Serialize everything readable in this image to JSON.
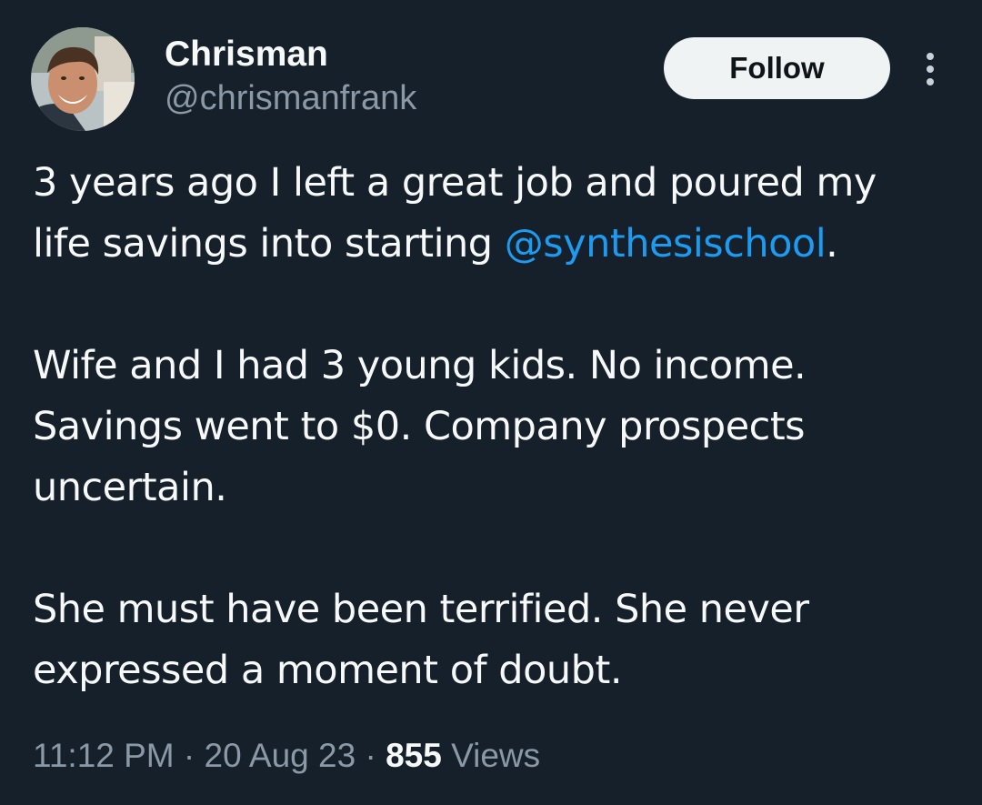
{
  "author": {
    "display_name": "Chrisman",
    "handle": "@chrismanfrank"
  },
  "actions": {
    "follow_label": "Follow",
    "more_icon": "more-vertical-icon"
  },
  "tweet": {
    "line1": "3 years ago I left a great job and poured my",
    "line2_prefix": "life savings into starting ",
    "mention": "@synthesischool",
    "line2_suffix": ".",
    "line3": "Wife and I had 3 young kids. No income.",
    "line4": "Savings went to $0. Company prospects",
    "line5": "uncertain.",
    "line6": "She must have been terrified. She never",
    "line7": "expressed a moment of doubt."
  },
  "meta": {
    "time": "11:12 PM",
    "sep1": " · ",
    "date": "20 Aug 23",
    "sep2": " · ",
    "views_count": "855",
    "views_label": " Views"
  },
  "colors": {
    "background": "#15202b",
    "text": "#f7f9f9",
    "secondary_text": "#8b98a5",
    "link": "#1d9bf0",
    "follow_button_bg": "#eff3f4"
  }
}
